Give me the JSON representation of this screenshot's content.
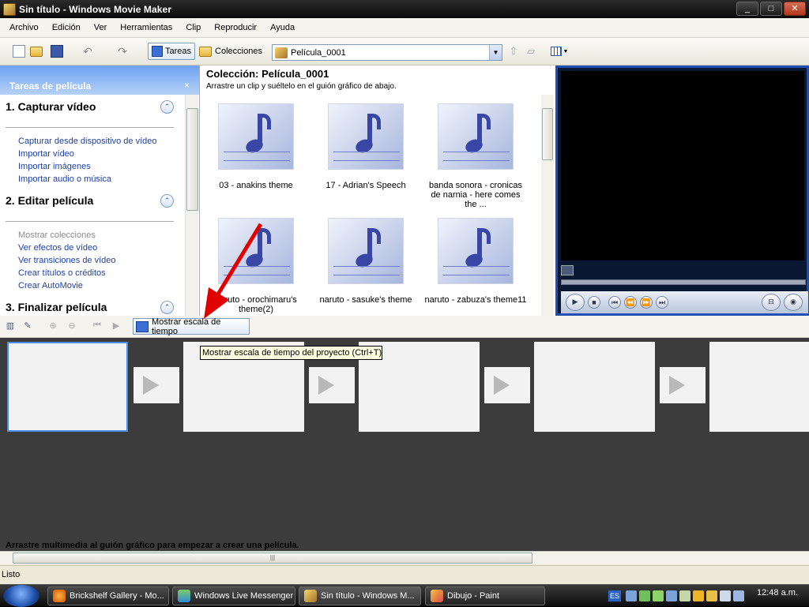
{
  "window": {
    "title": "Sin título - Windows Movie Maker",
    "min": "_",
    "max": "□",
    "close": "✕"
  },
  "menu": [
    "Archivo",
    "Edición",
    "Ver",
    "Herramientas",
    "Clip",
    "Reproducir",
    "Ayuda"
  ],
  "toolbar": {
    "tareas": "Tareas",
    "colecciones": "Colecciones",
    "collection_value": "Película_0001"
  },
  "taskpane": {
    "header": "Tareas de película",
    "close": "×",
    "sections": [
      {
        "title": "1. Capturar vídeo",
        "links": [
          "Capturar desde dispositivo de vídeo",
          "Importar vídeo",
          "Importar imágenes",
          "Importar audio o música"
        ]
      },
      {
        "title": "2. Editar película",
        "links": [
          "Mostrar colecciones",
          "Ver efectos de vídeo",
          "Ver transiciones de vídeo",
          "Crear títulos o créditos",
          "Crear AutoMovie"
        ]
      },
      {
        "title": "3. Finalizar película",
        "links": []
      }
    ],
    "collapse_glyph": "⌃"
  },
  "collection": {
    "title": "Colección: Película_0001",
    "subtitle": "Arrastre un clip y suéltelo en el guión gráfico de abajo.",
    "items": [
      {
        "label": "03 - anakins theme"
      },
      {
        "label": "17 - Adrian's Speech"
      },
      {
        "label": "banda sonora - cronicas de narnia - here comes the ..."
      },
      {
        "label": "naruto - orochimaru's theme(2)"
      },
      {
        "label": "naruto - sasuke's theme"
      },
      {
        "label": "naruto - zabuza's theme11"
      }
    ]
  },
  "preview": {
    "play": "▶",
    "stop": "■",
    "prev": "⏮",
    "rew": "⏪",
    "fwd": "⏩",
    "next": "⏭",
    "split": "⊟",
    "snapshot": "◉"
  },
  "storyboard": {
    "timeline_button": "Mostrar escala de tiempo",
    "tooltip": "Mostrar escala de tiempo del proyecto (Ctrl+T)",
    "hint": "Arrastre multimedia al guión gráfico para empezar a crear una película.",
    "scroll_grip": "|||"
  },
  "status": "Listo",
  "taskbar": {
    "tasks": [
      "Brickshelf Gallery - Mo...",
      "Windows Live Messenger",
      "Sin título - Windows M...",
      "Dibujo - Paint"
    ],
    "lang": "ES",
    "clock": "12:48 a.m."
  }
}
